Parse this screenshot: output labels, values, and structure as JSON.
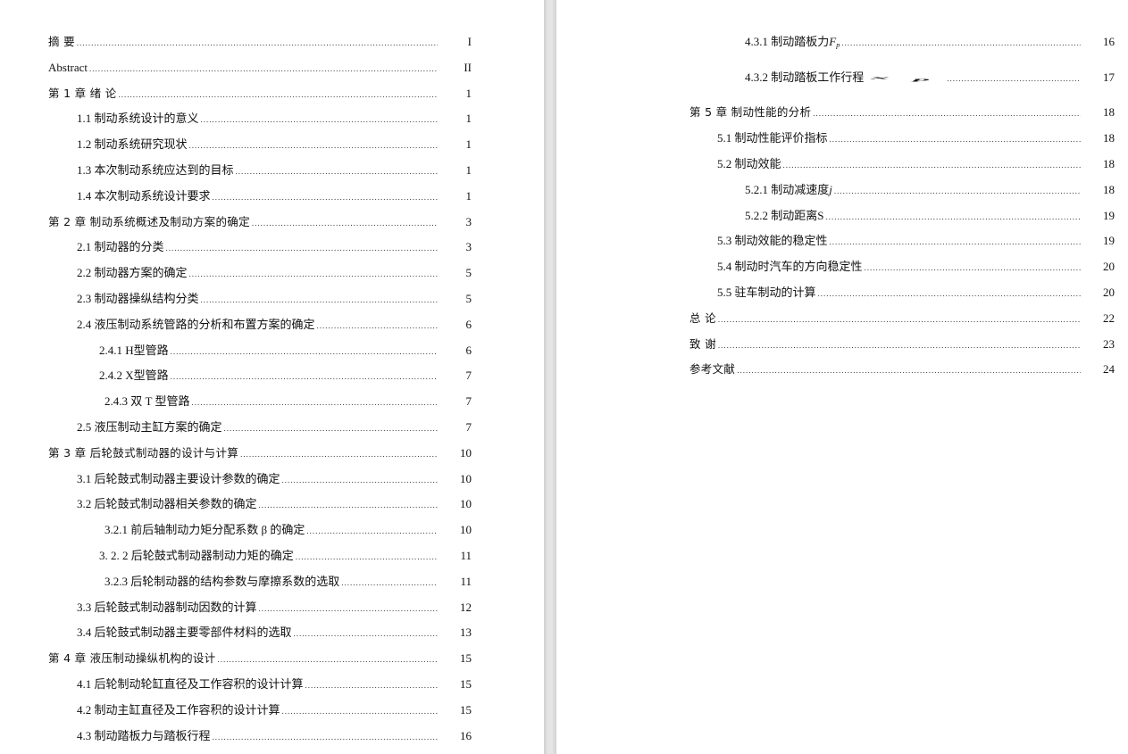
{
  "document": {
    "type": "table_of_contents",
    "pages": [
      {
        "id": "left",
        "entries": [
          {
            "level": 0,
            "label": "摘 要",
            "page": "I"
          },
          {
            "level": 0,
            "label": "Abstract",
            "page": "II",
            "plain": true
          },
          {
            "level": 0,
            "label": "第 1 章 绪 论",
            "page": "1"
          },
          {
            "level": 1,
            "label": "1.1  制动系统设计的意义",
            "page": "1"
          },
          {
            "level": 1,
            "label": "1.2  制动系统研究现状",
            "page": "1"
          },
          {
            "level": 1,
            "label": "1.3  本次制动系统应达到的目标",
            "page": "1"
          },
          {
            "level": 1,
            "label": "1.4  本次制动系统设计要求",
            "page": "1"
          },
          {
            "level": 0,
            "label": "第 2 章 制动系统概述及制动方案的确定",
            "page": "3"
          },
          {
            "level": 1,
            "label": "2.1  制动器的分类",
            "page": "3"
          },
          {
            "level": 1,
            "label": "2.2  制动器方案的确定",
            "page": "5"
          },
          {
            "level": 1,
            "label": "2.3  制动器操纵结构分类",
            "page": "5"
          },
          {
            "level": 1,
            "label": "2.4  液压制动系统管路的分析和布置方案的确定",
            "page": "6"
          },
          {
            "level": 2,
            "label": "2.4.1 H型管路",
            "page": "6"
          },
          {
            "level": 2,
            "label": "2.4.2 X型管路",
            "page": "7"
          },
          {
            "level": 3,
            "label": "2.4.3   双 T 型管路",
            "page": "7"
          },
          {
            "level": 1,
            "label": "2.5  液压制动主缸方案的确定",
            "page": "7"
          },
          {
            "level": 0,
            "label": "第 3 章 后轮鼓式制动器的设计与计算",
            "page": "10"
          },
          {
            "level": 1,
            "label": "3.1  后轮鼓式制动器主要设计参数的确定",
            "page": "10"
          },
          {
            "level": 1,
            "label": "3.2  后轮鼓式制动器相关参数的确定",
            "page": "10"
          },
          {
            "level": 3,
            "label": "3.2.1   前后轴制动力矩分配系数 β 的确定",
            "page": "10"
          },
          {
            "level": 2,
            "label": "3. 2. 2  后轮鼓式制动器制动力矩的确定",
            "page": "11"
          },
          {
            "level": 3,
            "label": "3.2.3   后轮制动器的结构参数与摩擦系数的选取",
            "page": "11"
          },
          {
            "level": 1,
            "label": "3.3  后轮鼓式制动器制动因数的计算",
            "page": "12"
          },
          {
            "level": 1,
            "label": "3.4  后轮鼓式制动器主要零部件材料的选取",
            "page": "13"
          },
          {
            "level": 0,
            "label": "第 4 章 液压制动操纵机构的设计",
            "page": "15"
          },
          {
            "level": 1,
            "label": "4.1  后轮制动轮缸直径及工作容积的设计计算",
            "page": "15"
          },
          {
            "level": 1,
            "label": "4.2  制动主缸直径及工作容积的设计计算",
            "page": "15"
          },
          {
            "level": 1,
            "label": "4.3  制动踏板力与踏板行程",
            "page": "16"
          }
        ]
      },
      {
        "id": "right",
        "entries": [
          {
            "level": 2,
            "label": "4.3.1  制动踏板力 ",
            "math": "F",
            "math_sub": "p",
            "page": "16"
          },
          {
            "level": 2,
            "label": "4.3.2  制动踏板工作行程 ",
            "math_stretched": "x",
            "math_sub": "p",
            "page": "17"
          },
          {
            "level": 0,
            "label": "第 5 章 制动性能的分析",
            "page": "18"
          },
          {
            "level": 1,
            "label": "5.1  制动性能评价指标",
            "page": "18"
          },
          {
            "level": 1,
            "label": "5.2  制动效能",
            "page": "18"
          },
          {
            "level": 2,
            "label": "5.2.1  制动减速度 ",
            "math": "j",
            "page": "18"
          },
          {
            "level": 2,
            "label": "5.2.2  制动距离S",
            "page": "19"
          },
          {
            "level": 1,
            "label": "5.3  制动效能的稳定性",
            "page": "19"
          },
          {
            "level": 1,
            "label": "5.4  制动时汽车的方向稳定性",
            "page": "20"
          },
          {
            "level": 1,
            "label": "5.5  驻车制动的计算",
            "page": "20"
          },
          {
            "level": 0,
            "label": "总 论",
            "page": "22"
          },
          {
            "level": 0,
            "label": "致 谢",
            "page": "23"
          },
          {
            "level": 0,
            "label": "参考文献",
            "page": "24"
          }
        ]
      }
    ]
  }
}
